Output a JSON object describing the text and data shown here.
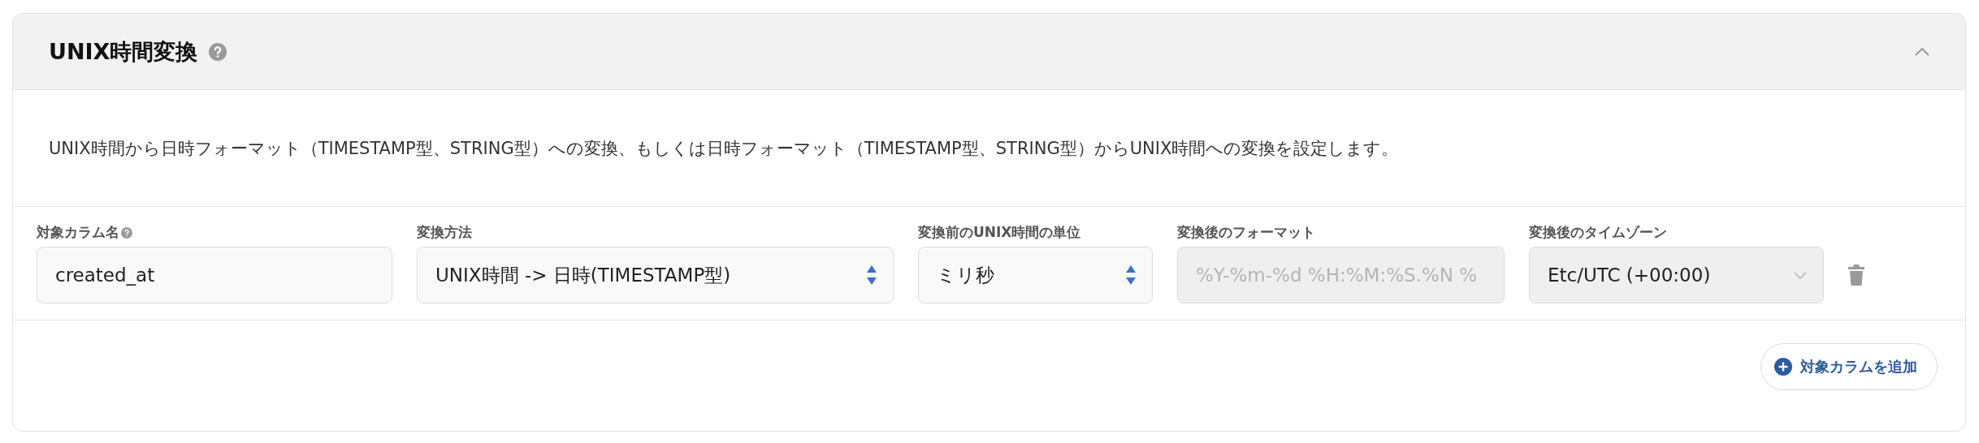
{
  "panel": {
    "title": "UNIX時間変換",
    "expanded": true,
    "description": "UNIX時間から日時フォーマット（TIMESTAMP型、STRING型）への変換、もしくは日時フォーマット（TIMESTAMP型、STRING型）からUNIX時間への変換を設定します。"
  },
  "fields": [
    {
      "kind": "text",
      "label": "対象カラム名",
      "help": true,
      "value": "created_at",
      "disabled": false
    },
    {
      "kind": "select",
      "label": "変換方法",
      "help": false,
      "value": "UNIX時間 -> 日時(TIMESTAMP型)",
      "disabled": false
    },
    {
      "kind": "select",
      "label": "変換前のUNIX時間の単位",
      "help": false,
      "value": "ミリ秒",
      "disabled": false
    },
    {
      "kind": "text",
      "label": "変換後のフォーマット",
      "help": false,
      "placeholder": "%Y-%m-%d %H:%M:%S.%N %",
      "disabled": true
    },
    {
      "kind": "select",
      "label": "変換後のタイムゾーン",
      "help": false,
      "value": "Etc/UTC (+00:00)",
      "disabled": true
    }
  ],
  "add_button": {
    "label": "対象カラムを追加"
  }
}
